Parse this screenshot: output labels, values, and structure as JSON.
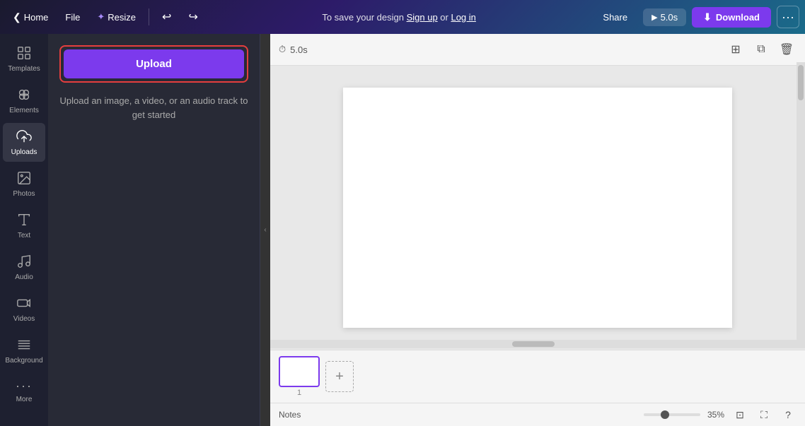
{
  "topnav": {
    "home_label": "Home",
    "file_label": "File",
    "resize_label": "Resize",
    "save_hint": "To save your design ",
    "sign_up": "Sign up",
    "or": " or ",
    "log_in": "Log in",
    "share_label": "Share",
    "duration_label": "5.0s",
    "download_label": "Download",
    "more_label": "···"
  },
  "sidebar": {
    "items": [
      {
        "id": "templates",
        "label": "Templates",
        "icon": "grid"
      },
      {
        "id": "elements",
        "label": "Elements",
        "icon": "elements"
      },
      {
        "id": "uploads",
        "label": "Uploads",
        "icon": "upload"
      },
      {
        "id": "photos",
        "label": "Photos",
        "icon": "photos"
      },
      {
        "id": "text",
        "label": "Text",
        "icon": "text"
      },
      {
        "id": "audio",
        "label": "Audio",
        "icon": "audio"
      },
      {
        "id": "videos",
        "label": "Videos",
        "icon": "videos"
      },
      {
        "id": "background",
        "label": "Background",
        "icon": "background"
      },
      {
        "id": "more",
        "label": "More",
        "icon": "more"
      }
    ]
  },
  "left_panel": {
    "upload_btn_label": "Upload",
    "upload_hint": "Upload an image, a video, or an audio track to get started"
  },
  "canvas": {
    "duration": "5.0s",
    "add_page_btn": "+",
    "page_number": "1",
    "collapse_icon": "‹"
  },
  "status_bar": {
    "notes_label": "Notes",
    "zoom_level": "35%"
  }
}
